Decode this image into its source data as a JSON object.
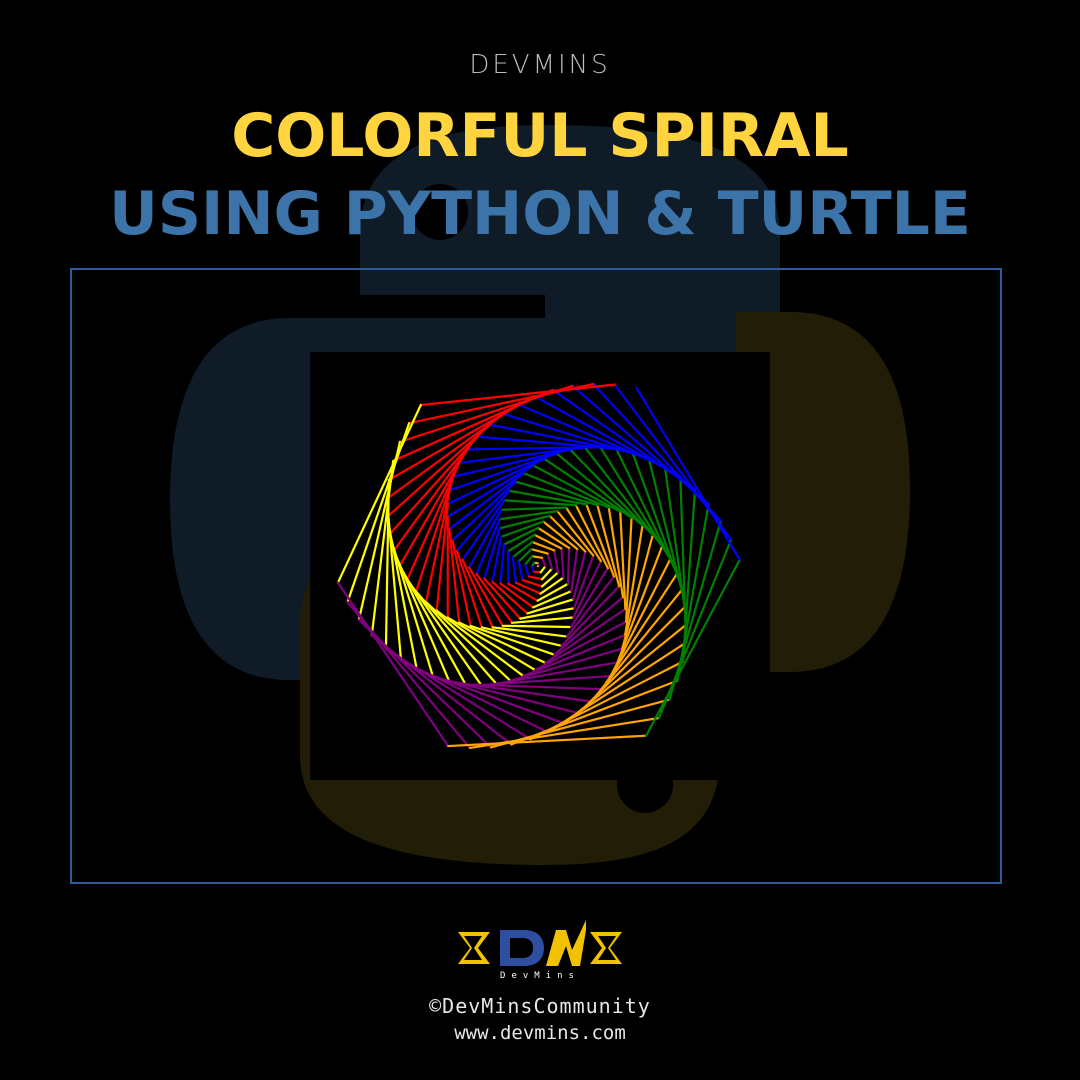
{
  "brand": "DEVMINS",
  "title": {
    "line1": "COLORFUL SPIRAL",
    "line2": "USING PYTHON & TURTLE"
  },
  "artwork": {
    "palette": [
      "#ff0000",
      "#ffff00",
      "#800080",
      "#ffa500",
      "#008000",
      "#0000ff"
    ],
    "background_logo_icon": "python-logo-icon"
  },
  "footer": {
    "logo_text": "DevMins",
    "handle": "©DevMinsCommunity",
    "url": "www.devmins.com"
  },
  "colors": {
    "title_yellow": "#ffd43f",
    "title_blue": "#3c73a8",
    "frame_border": "#2e5a9a",
    "background": "#000000"
  }
}
